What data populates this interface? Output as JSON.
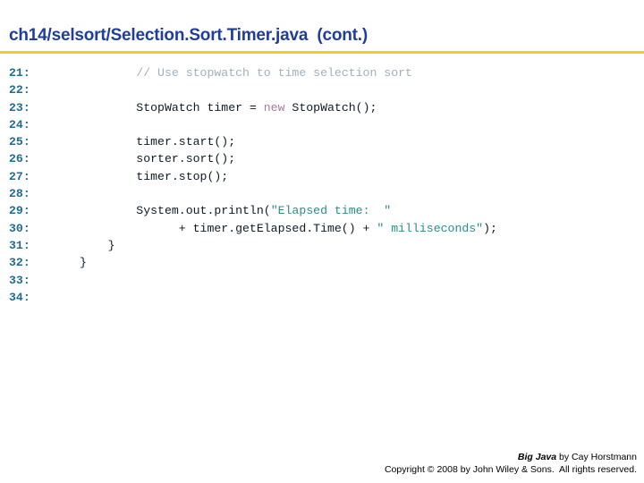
{
  "slide": {
    "title": "ch14/selsort/Selection.Sort.Timer.java  (cont.)",
    "title_color": "#1f3d9b",
    "rule_color": "#f5cd1e"
  },
  "code": {
    "lineno_color": "#1f6c8c",
    "comment_color": "#9fb0be",
    "keyword_color": "#a57a9c",
    "string_color": "#2f8a8a",
    "plain_color": "#0d1a26",
    "lines": [
      {
        "number": "21:",
        "text": "        // Use stopwatch to time selection sort",
        "tokens": [
          {
            "t": "        ",
            "k": "plain"
          },
          {
            "t": "// Use stopwatch to time selection sort",
            "k": "comment"
          }
        ]
      },
      {
        "number": "22:",
        "text": "",
        "tokens": []
      },
      {
        "number": "23:",
        "text": "        StopWatch timer = new StopWatch();",
        "tokens": [
          {
            "t": "        StopWatch timer = ",
            "k": "plain"
          },
          {
            "t": "new",
            "k": "keyword"
          },
          {
            "t": " StopWatch();",
            "k": "plain"
          }
        ]
      },
      {
        "number": "24:",
        "text": "",
        "tokens": []
      },
      {
        "number": "25:",
        "text": "        timer.start();",
        "tokens": [
          {
            "t": "        timer.start();",
            "k": "plain"
          }
        ]
      },
      {
        "number": "26:",
        "text": "        sorter.sort();",
        "tokens": [
          {
            "t": "        sorter.sort();",
            "k": "plain"
          }
        ]
      },
      {
        "number": "27:",
        "text": "        timer.stop();",
        "tokens": [
          {
            "t": "        timer.stop();",
            "k": "plain"
          }
        ]
      },
      {
        "number": "28:",
        "text": "",
        "tokens": []
      },
      {
        "number": "29:",
        "text": "        System.out.println(\"Elapsed time:  \"",
        "tokens": [
          {
            "t": "        System.out.println(",
            "k": "plain"
          },
          {
            "t": "\"Elapsed time:  \"",
            "k": "string"
          }
        ]
      },
      {
        "number": "30:",
        "text": "              + timer.getElapsed.Time() + \" milliseconds\");",
        "tokens": [
          {
            "t": "              + timer.getElapsed.Time() + ",
            "k": "plain"
          },
          {
            "t": "\" milliseconds\"",
            "k": "string"
          },
          {
            "t": ");",
            "k": "plain"
          }
        ]
      },
      {
        "number": "31:",
        "text": "    }",
        "tokens": [
          {
            "t": "    }",
            "k": "plain"
          }
        ]
      },
      {
        "number": "32:",
        "text": "}",
        "tokens": [
          {
            "t": "}",
            "k": "plain"
          }
        ]
      },
      {
        "number": "33:",
        "text": "",
        "tokens": []
      },
      {
        "number": "34:",
        "text": "",
        "tokens": []
      }
    ]
  },
  "footer": {
    "book_title": "Big Java",
    "byline": " by Cay Horstmann",
    "copyright": "Copyright © 2008 by John Wiley & Sons.  All rights reserved."
  }
}
